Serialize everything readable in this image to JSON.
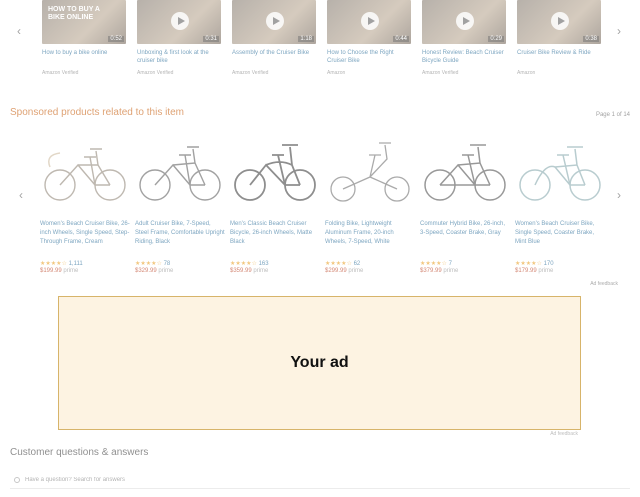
{
  "videos": [
    {
      "title": "How to buy a bike online",
      "meta": "Amazon Verified",
      "duration": "0:52",
      "overlay": "HOW TO BUY A BIKE ONLINE"
    },
    {
      "title": "Unboxing & first look at the cruiser bike",
      "meta": "Amazon Verified",
      "duration": "0:31",
      "overlay": ""
    },
    {
      "title": "Assembly of the Cruiser Bike",
      "meta": "Amazon Verified",
      "duration": "1:18",
      "overlay": ""
    },
    {
      "title": "How to Choose the Right Cruiser Bike",
      "meta": "Amazon",
      "duration": "0:44",
      "overlay": ""
    },
    {
      "title": "Honest Review: Beach Cruiser Bicycle Guide",
      "meta": "Amazon Verified",
      "duration": "0:29",
      "overlay": ""
    },
    {
      "title": "Cruiser Bike Review & Ride",
      "meta": "Amazon",
      "duration": "0:38",
      "overlay": ""
    }
  ],
  "sponsored": {
    "heading": "Sponsored products related to this item",
    "page_count": "Page 1 of 14",
    "ad_feedback": "Ad feedback",
    "products": [
      {
        "title": "Women's Beach Cruiser Bike, 26-inch Wheels, Single Speed, Step-Through Frame, Cream",
        "stars": "★★★★☆",
        "count": "1,111",
        "price": "$199.99",
        "prime": "prime"
      },
      {
        "title": "Adult Cruiser Bike, 7-Speed, Steel Frame, Comfortable Upright Riding, Black",
        "stars": "★★★★☆",
        "count": "78",
        "price": "$329.99",
        "prime": "prime"
      },
      {
        "title": "Men's Classic Beach Cruiser Bicycle, 26-inch Wheels, Matte Black",
        "stars": "★★★★☆",
        "count": "163",
        "price": "$359.99",
        "prime": "prime"
      },
      {
        "title": "Folding Bike, Lightweight Aluminum Frame, 20-inch Wheels, 7-Speed, White",
        "stars": "★★★★☆",
        "count": "62",
        "price": "$299.99",
        "prime": "prime"
      },
      {
        "title": "Commuter Hybrid Bike, 26-inch, 3-Speed, Coaster Brake, Gray",
        "stars": "★★★★☆",
        "count": "7",
        "price": "$379.99",
        "prime": "prime"
      },
      {
        "title": "Women's Beach Cruiser Bike, Single Speed, Coaster Brake, Mint Blue",
        "stars": "★★★★☆",
        "count": "170",
        "price": "$179.99",
        "prime": "prime"
      }
    ]
  },
  "ad": {
    "label": "Your ad",
    "feedback": "Ad feedback"
  },
  "qa": {
    "heading": "Customer questions & answers",
    "placeholder": "Have a question? Search for answers"
  },
  "colors": {
    "ad_bg": "#fdf3e2",
    "ad_border": "#d7b46a",
    "sponsored_heading": "#c45500",
    "link": "#0f5a8c",
    "price": "#b12704",
    "stars": "#e99b18"
  }
}
